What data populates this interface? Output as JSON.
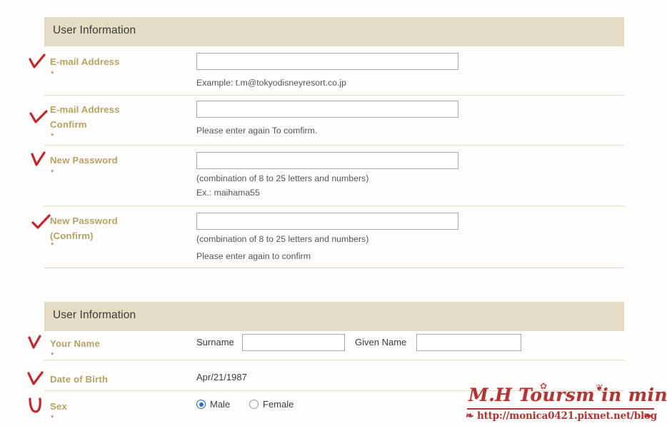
{
  "sections": [
    {
      "id": "account",
      "title": "User Information",
      "rows": [
        {
          "id": "email",
          "label": "E-mail Address",
          "required_mark": "*",
          "input_value": "",
          "input_placeholder": "",
          "hints": [
            "Example: t.m@tokyodisneyresort.co.jp"
          ],
          "annotation": "red-check"
        },
        {
          "id": "email-confirm",
          "label": "E-mail Address\nConfirm",
          "required_mark": "*",
          "input_value": "",
          "input_placeholder": "",
          "hints": [
            "Please enter again To comfirm."
          ],
          "annotation": "red-check"
        },
        {
          "id": "new-password",
          "label": "New Password",
          "required_mark": "*",
          "input_value": "",
          "input_placeholder": "",
          "hints": [
            "(combination of 8 to 25 letters and numbers)",
            "Ex.: maihama55"
          ],
          "annotation": "red-check"
        },
        {
          "id": "new-password-confirm",
          "label": "New Password\n(Confirm)",
          "required_mark": "*",
          "input_value": "",
          "input_placeholder": "",
          "hints": [
            "(combination of 8 to 25 letters and numbers)",
            "Please enter again to confirm"
          ],
          "annotation": "red-check"
        }
      ]
    },
    {
      "id": "personal",
      "title": "User Information",
      "rows": [
        {
          "id": "your-name",
          "label": "Your Name",
          "required_mark": "*",
          "surname_label": "Surname",
          "surname_value": "",
          "given_name_label": "Given Name",
          "given_name_value": "",
          "annotation": "red-check"
        },
        {
          "id": "date-of-birth",
          "label": "Date of Birth",
          "required_mark": "",
          "value": "Apr/21/1987",
          "annotation": "red-check"
        },
        {
          "id": "sex",
          "label": "Sex",
          "required_mark": "*",
          "options": [
            {
              "label": "Male",
              "selected": true
            },
            {
              "label": "Female",
              "selected": false
            }
          ],
          "annotation": "red-check"
        }
      ]
    }
  ],
  "watermark": {
    "title": "M.H Toursm in mind",
    "url": "http://monica0421.pixnet.net/blog",
    "ornament_left": "❧",
    "ornament_right": "❧",
    "flower": "✿",
    "bow": "❦"
  },
  "colors": {
    "header_bar": "#e4ddc4",
    "label": "#b6a263",
    "required": "#b0605c",
    "rule": "#e6dfc6",
    "section_rule": "#e0cfc5",
    "radio_accent": "#2a6fd0",
    "annotation": "#c1272d",
    "watermark": "#b03535",
    "page_background": "#fefdfb"
  }
}
